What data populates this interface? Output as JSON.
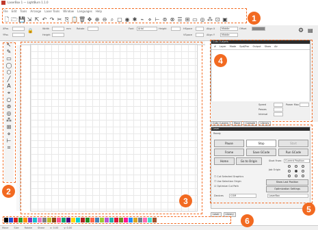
{
  "window": {
    "title": "LaserBox 1 — LightBurn 1.1.0"
  },
  "menu": [
    "File",
    "Edit",
    "Tools",
    "Arrange",
    "Laser Tools",
    "Window",
    "Languages",
    "Help"
  ],
  "toolbar_icons": [
    "new-file-icon",
    "open-file-icon",
    "save-icon",
    "import-icon",
    "export-icon",
    "undo-icon",
    "redo-icon",
    "cut-icon",
    "copy-icon",
    "paste-icon",
    "delete-icon",
    "move-icon",
    "zoom-in-icon",
    "zoom-out-icon",
    "zoom-frame-icon",
    "frame-icon",
    "camera-icon",
    "settings-icon",
    "trace-icon",
    "node-icon",
    "measure-icon",
    "offset-icon",
    "boolean-icon",
    "align-icon",
    "grid-icon",
    "dock-icon",
    "weld-icon",
    "array-icon",
    "close-path-icon",
    "preview-icon"
  ],
  "propbar": {
    "xpos_label": "XPos",
    "ypos_label": "YPos",
    "width_label": "Width",
    "height_label": "Height",
    "units": "mm",
    "rotate_label": "Rotate",
    "font_label": "Font",
    "font_value": "Arial",
    "height2_label": "Height",
    "hspace_label": "HSpace",
    "vspace_label": "VSpace",
    "align_x_label": "Align X",
    "align_x_value": "Middle",
    "align_y_label": "Align Y",
    "align_y_value": "Middle",
    "offset_label": "Offset"
  },
  "left_tools": [
    "select-icon",
    "pen-icon",
    "rectangle-icon",
    "ellipse-icon",
    "polygon-icon",
    "line-icon",
    "text-icon",
    "position-icon",
    "circle-icon",
    "offset-icon",
    "weld-icon",
    "array-icon",
    "grid-array-icon",
    "edit-nodes-icon",
    "measure-icon",
    "crop-icon"
  ],
  "cuts_layers": {
    "header": "Cuts / Layers",
    "columns": [
      "#",
      "Layer",
      "Mode",
      "Spd/Pwr",
      "Output",
      "Show",
      "Air"
    ],
    "speed_label": "Speed",
    "pass_label": "Passes",
    "interval_label": "Interval",
    "power_label": "Power Max"
  },
  "panel_tabs": [
    "Cuts / Layers",
    "Move",
    "Console",
    "Library"
  ],
  "laser": {
    "header": "Laser",
    "status": "Ready",
    "pause": "Pause",
    "stop": "Stop",
    "start": "Start",
    "frame": "Frame",
    "save_gcode": "Save GCode",
    "run_gcode": "Run GCode",
    "home": "Home",
    "go_to_origin": "Go to Origin",
    "start_from": "Start From:",
    "start_from_value": "Current Position",
    "job_origin": "Job Origin",
    "cut_selected": "Cut Selected Graphics",
    "use_selection_origin": "Use Selection Origin",
    "optimize_cut_path": "Optimize Cut Path",
    "show_last_position": "Show Last Position",
    "optimization_settings": "Optimization Settings",
    "devices_label": "Devices",
    "device_value": "COM",
    "device_name": "LaserBox"
  },
  "bottom_tabs": [
    "Laser",
    "Library"
  ],
  "palette": [
    "#000000",
    "#1f4fd8",
    "#d82020",
    "#2ca02c",
    "#ff8c00",
    "#8c2db8",
    "#17becf",
    "#e377c2",
    "#7f7f7f",
    "#bcbd22",
    "#8b4513",
    "#ff4f8b",
    "#00a36c",
    "#4b0082",
    "#ffd700",
    "#00ced1",
    "#b22222",
    "#228b22",
    "#ff6347",
    "#4682b4",
    "#9acd32",
    "#ba55d3",
    "#20b2aa",
    "#dc143c",
    "#6b8e23",
    "#ff1493",
    "#1e90ff",
    "#daa520",
    "#708090",
    "#ff69b4",
    "#40e0d0",
    "#a0522d"
  ],
  "status": [
    "Move",
    "Size",
    "Rotate",
    "Shear",
    "x: 0.00",
    "y: 0.00"
  ],
  "callouts": [
    "1",
    "2",
    "3",
    "4",
    "5",
    "6"
  ],
  "colors": {
    "accent": "#f26a21"
  }
}
